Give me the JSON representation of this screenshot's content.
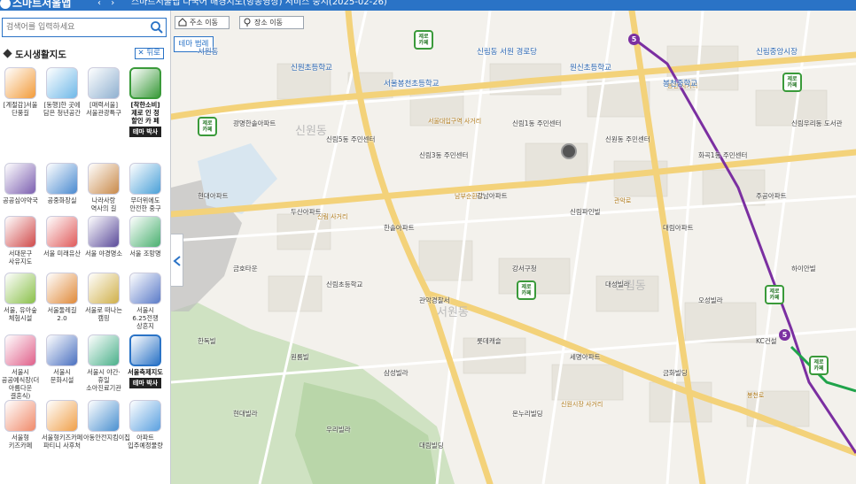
{
  "topbar": {
    "brand": "스마트서울맵",
    "nav_prev": "‹",
    "nav_next": "›",
    "page_title": "스마트서울맵 다국어 배경지도(항공영상) 서비스 중지(2025-02-26)"
  },
  "sidebar": {
    "search_placeholder": "검색어를 입력하세요",
    "section_title": "도시생활지도",
    "back_label": "뒤로",
    "tiles": [
      {
        "label": "[계절감]서울 단풍길",
        "icon": "autumn-leaf-icon",
        "color": "#f29b3a"
      },
      {
        "label": "[동행]한 곳에 담은 청년공간",
        "icon": "youth-space-icon",
        "color": "#6fb8e8"
      },
      {
        "label": "[매력서울] 서울관광특구",
        "icon": "tourism-zone-icon",
        "color": "#8fb0d0"
      },
      {
        "label": "[착한소비] 제로 인 정 할인 카 페",
        "icon": "zero-cafe-icon",
        "color": "#3a9a3a",
        "tag": "테마 박사",
        "selected": true
      },
      {
        "label": "공공심야약국",
        "icon": "night-pharmacy-icon",
        "color": "#7c5fb0"
      },
      {
        "label": "공중화장실",
        "icon": "toilet-icon",
        "color": "#4a8ad0"
      },
      {
        "label": "나라사랑 역사의 길",
        "icon": "history-road-icon",
        "color": "#c98a4a"
      },
      {
        "label": "무더위에도 안전한 중구",
        "icon": "heat-safety-icon",
        "color": "#4aa0d8"
      },
      {
        "label": "서대문구 사유지도",
        "icon": "seodaemun-map-icon",
        "color": "#d04a4a"
      },
      {
        "label": "서울 미래유산",
        "icon": "future-heritage-icon",
        "color": "#e05a5a"
      },
      {
        "label": "서울 야경명소",
        "icon": "night-view-icon",
        "color": "#5a4a9a"
      },
      {
        "label": "서울 조망명",
        "icon": "viewpoint-icon",
        "color": "#4ab070"
      },
      {
        "label": "서울, 유아숲 체험시설",
        "icon": "forest-kid-icon",
        "color": "#8ac04a"
      },
      {
        "label": "서울둘레길 2.0",
        "icon": "trail-icon",
        "color": "#e08a3a"
      },
      {
        "label": "서울로 떠나는 캠핑",
        "icon": "camping-icon",
        "color": "#d0b04a"
      },
      {
        "label": "서울시 6.25전쟁 상흔지",
        "icon": "war-memorial-icon",
        "color": "#5a7ac8"
      },
      {
        "label": "서울시 공공예식장(더 아름다운 결혼식)",
        "icon": "wedding-icon",
        "color": "#e0608a"
      },
      {
        "label": "서울시 문화시설",
        "icon": "culture-icon",
        "color": "#4a70c0"
      },
      {
        "label": "서울시 야간·휴일 소아진료기관",
        "icon": "pediatric-icon",
        "color": "#4ab08a"
      },
      {
        "label": "서울축제지도",
        "icon": "festival-icon",
        "color": "#2a73c6",
        "tag": "테마 박사",
        "selected": true
      },
      {
        "label": "서울형 키즈카페",
        "icon": "kids-cafe-icon",
        "color": "#f08a6a"
      },
      {
        "label": "서울형키즈카페 파티니 사후처",
        "icon": "kids-cafe-2-icon",
        "color": "#f0a04a"
      },
      {
        "label": "아동안전지킴이집",
        "icon": "child-safety-icon",
        "color": "#4a90d0"
      },
      {
        "label": "아파트 입주예정물량",
        "icon": "apartment-icon",
        "color": "#5aa0e0"
      }
    ]
  },
  "map": {
    "btn_home": "주소 이동",
    "btn_place": "장소 이동",
    "legend_btn": "테마 범례",
    "district_labels": [
      "신원동",
      "서원동",
      "신림동"
    ],
    "road_labels": [
      "신림 사거리",
      "서울대입구역 사거리",
      "봉천 사거리",
      "신원시장 사거리",
      "관악로",
      "남부순환로",
      "봉천로"
    ],
    "labels": [
      "서원동",
      "신원초등학교",
      "서울봉천초등학교",
      "신림동 서원 경로당",
      "원신초등학교",
      "봉천중학교",
      "신림중앙시장",
      "광명한솔아파트",
      "신림5동 주민센터",
      "신림3동 주민센터",
      "신림1동 주민센터",
      "신원동 주민센터",
      "화곡1동 주민센터",
      "신림우리동 도서관",
      "현대아파트",
      "두산아파트",
      "한솔아파트",
      "강남아파트",
      "신림파인빌",
      "대림아파트",
      "주공아파트",
      "금호타운",
      "신림초등학교",
      "관악경찰서",
      "강서구청",
      "대성빌라",
      "오성빌라",
      "하이안빌",
      "한독빌",
      "원룸빌",
      "삼성빌라",
      "롯데캐슬",
      "세명아파트",
      "금화빌딩",
      "KC건설",
      "현대빌라",
      "우리빌라",
      "대림빌딩",
      "온누리빌딩"
    ],
    "cafes": [
      {
        "label": "제로 카페"
      },
      {
        "label": "제로 카페"
      },
      {
        "label": "제로 카페"
      },
      {
        "label": "제로 카페"
      },
      {
        "label": "제로 카페"
      },
      {
        "label": "제로 카페"
      }
    ],
    "metro_labels": [
      "5",
      "5"
    ]
  }
}
